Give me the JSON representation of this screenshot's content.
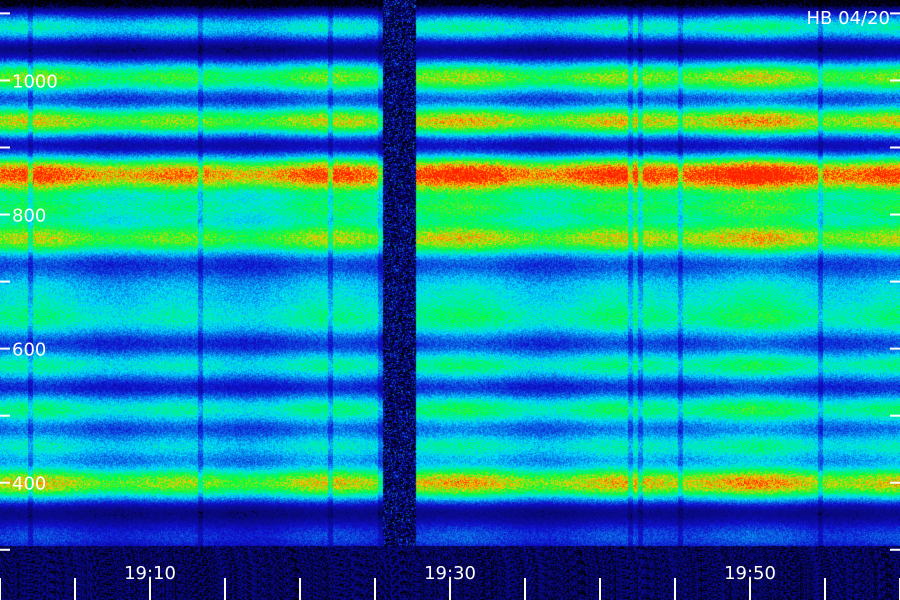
{
  "tag": "HB 04/20",
  "chart_data": {
    "type": "heatmap",
    "title": "",
    "xlabel": "",
    "ylabel": "",
    "x_tick_labels": [
      "19:10",
      "19:30",
      "19:50"
    ],
    "x_range": [
      "19:00",
      "19:60"
    ],
    "y_tick_labels": [
      "1000",
      "800",
      "600",
      "400"
    ],
    "y_range": [
      240,
      1120
    ],
    "colormap": [
      "#000020",
      "#1010d0",
      "#00e0ff",
      "#00ff30",
      "#ffd000",
      "#ff2000"
    ],
    "gap": {
      "start": "19:25.5",
      "end": "19:27.7"
    },
    "bands": [
      {
        "center": 1080,
        "intensity": 0.42,
        "width": 22
      },
      {
        "center": 1005,
        "intensity": 0.62,
        "width": 26
      },
      {
        "center": 940,
        "intensity": 0.7,
        "width": 24
      },
      {
        "center": 860,
        "intensity": 0.92,
        "width": 28
      },
      {
        "center": 810,
        "intensity": 0.45,
        "width": 22
      },
      {
        "center": 765,
        "intensity": 0.66,
        "width": 26
      },
      {
        "center": 690,
        "intensity": 0.35,
        "width": 40
      },
      {
        "center": 640,
        "intensity": 0.38,
        "width": 30
      },
      {
        "center": 575,
        "intensity": 0.45,
        "width": 26
      },
      {
        "center": 510,
        "intensity": 0.48,
        "width": 26
      },
      {
        "center": 455,
        "intensity": 0.4,
        "width": 24
      },
      {
        "center": 400,
        "intensity": 0.72,
        "width": 26
      },
      {
        "center": 320,
        "intensity": 0.22,
        "width": 30
      }
    ]
  }
}
